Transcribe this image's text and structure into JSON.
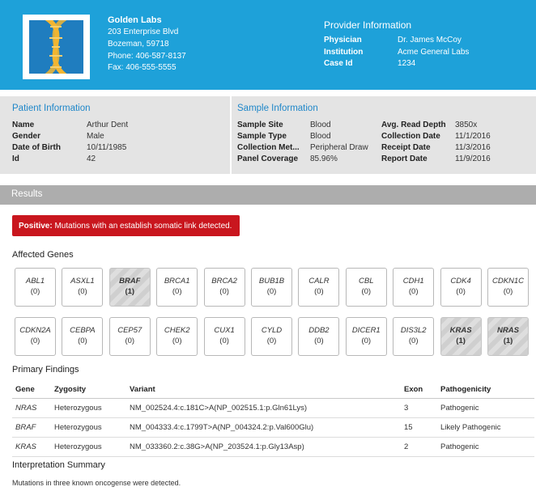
{
  "lab": {
    "name": "Golden Labs",
    "address1": "203 Enterprise Blvd",
    "address2": "Bozeman, 59718",
    "phone": "Phone: 406-587-8137",
    "fax": "Fax: 406-555-5555",
    "logo_icon": "dna-helix-icon"
  },
  "provider": {
    "title": "Provider Information",
    "physician_label": "Physician",
    "physician": "Dr. James McCoy",
    "institution_label": "Institution",
    "institution": "Acme General Labs",
    "case_label": "Case Id",
    "case_id": "1234"
  },
  "patient": {
    "title": "Patient Information",
    "name_label": "Name",
    "name": "Arthur Dent",
    "gender_label": "Gender",
    "gender": "Male",
    "dob_label": "Date of Birth",
    "dob": "10/11/1985",
    "id_label": "Id",
    "id": "42"
  },
  "sample": {
    "title": "Sample Information",
    "site_label": "Sample Site",
    "site": "Blood",
    "type_label": "Sample Type",
    "type": "Blood",
    "method_label": "Collection Met...",
    "method": "Peripheral Draw",
    "coverage_label": "Panel Coverage",
    "coverage": "85.96%",
    "depth_label": "Avg. Read Depth",
    "depth": "3850x",
    "collection_date_label": "Collection Date",
    "collection_date": "11/1/2016",
    "receipt_date_label": "Receipt Date",
    "receipt_date": "11/3/2016",
    "report_date_label": "Report Date",
    "report_date": "11/9/2016"
  },
  "results": {
    "title": "Results",
    "alert_strong": "Positive:",
    "alert_text": " Mutations with an establish somatic link detected.",
    "affected_title": "Affected Genes",
    "genes_row1": [
      {
        "name": "ABL1",
        "count": "(0)",
        "positive": false
      },
      {
        "name": "ASXL1",
        "count": "(0)",
        "positive": false
      },
      {
        "name": "BRAF",
        "count": "(1)",
        "positive": true
      },
      {
        "name": "BRCA1",
        "count": "(0)",
        "positive": false
      },
      {
        "name": "BRCA2",
        "count": "(0)",
        "positive": false
      },
      {
        "name": "BUB1B",
        "count": "(0)",
        "positive": false
      },
      {
        "name": "CALR",
        "count": "(0)",
        "positive": false
      },
      {
        "name": "CBL",
        "count": "(0)",
        "positive": false
      },
      {
        "name": "CDH1",
        "count": "(0)",
        "positive": false
      },
      {
        "name": "CDK4",
        "count": "(0)",
        "positive": false
      },
      {
        "name": "CDKN1C",
        "count": "(0)",
        "positive": false
      }
    ],
    "genes_row2": [
      {
        "name": "CDKN2A",
        "count": "(0)",
        "positive": false
      },
      {
        "name": "CEBPA",
        "count": "(0)",
        "positive": false
      },
      {
        "name": "CEP57",
        "count": "(0)",
        "positive": false
      },
      {
        "name": "CHEK2",
        "count": "(0)",
        "positive": false
      },
      {
        "name": "CUX1",
        "count": "(0)",
        "positive": false
      },
      {
        "name": "CYLD",
        "count": "(0)",
        "positive": false
      },
      {
        "name": "DDB2",
        "count": "(0)",
        "positive": false
      },
      {
        "name": "DICER1",
        "count": "(0)",
        "positive": false
      },
      {
        "name": "DIS3L2",
        "count": "(0)",
        "positive": false
      },
      {
        "name": "KRAS",
        "count": "(1)",
        "positive": true
      },
      {
        "name": "NRAS",
        "count": "(1)",
        "positive": true
      }
    ],
    "findings_title": "Primary Findings",
    "findings_headers": {
      "gene": "Gene",
      "zygosity": "Zygosity",
      "variant": "Variant",
      "exon": "Exon",
      "pathogenicity": "Pathogenicity"
    },
    "findings": [
      {
        "gene": "NRAS",
        "zygosity": "Heterozygous",
        "variant": "NM_002524.4:c.181C>A(NP_002515.1:p.Gln61Lys)",
        "exon": "3",
        "pathogenicity": "Pathogenic"
      },
      {
        "gene": "BRAF",
        "zygosity": "Heterozygous",
        "variant": "NM_004333.4:c.1799T>A(NP_004324.2:p.Val600Glu)",
        "exon": "15",
        "pathogenicity": "Likely Pathogenic"
      },
      {
        "gene": "KRAS",
        "zygosity": "Heterozygous",
        "variant": "NM_033360.2:c.38G>A(NP_203524.1:p.Gly13Asp)",
        "exon": "2",
        "pathogenicity": "Pathogenic"
      }
    ],
    "interpretation_title": "Interpretation Summary",
    "interpretation_text": "Mutations in three known oncogense were detected."
  },
  "colors": {
    "header_bg": "#1ea1d9",
    "accent_title": "#1f87c9",
    "alert_bg": "#c9161e",
    "results_bar": "#adadad",
    "logo_bg": "#1f7dbf",
    "helix_gold": "#f2b531"
  }
}
